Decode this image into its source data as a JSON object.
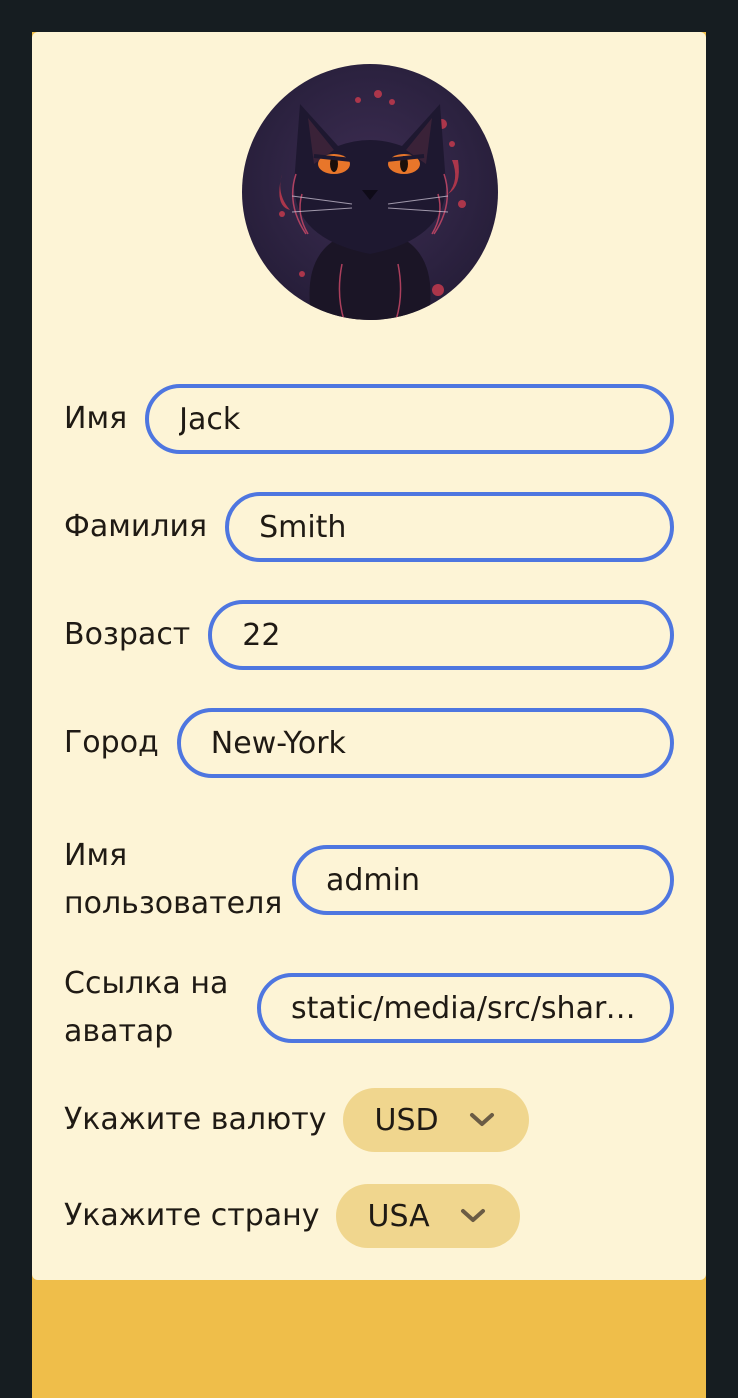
{
  "profile": {
    "first_name_label": "Имя",
    "first_name_value": "Jack",
    "last_name_label": "Фамилия",
    "last_name_value": "Smith",
    "age_label": "Возраст",
    "age_value": "22",
    "city_label": "Город",
    "city_value": "New-York",
    "username_label": "Имя пользователя",
    "username_value": "admin",
    "avatar_link_label": "Ссылка на аватар",
    "avatar_link_value": "static/media/src/share…"
  },
  "currency": {
    "label": "Укажите валюту",
    "value": "USD"
  },
  "country": {
    "label": "Укажите страну",
    "value": "USA"
  },
  "avatar": {
    "icon": "black-cat-avatar"
  },
  "colors": {
    "background": "#161d21",
    "card": "#fdf4d6",
    "footer_band": "#efbe4a",
    "field_border": "#4e76e0",
    "select_bg": "#f0d68e"
  }
}
